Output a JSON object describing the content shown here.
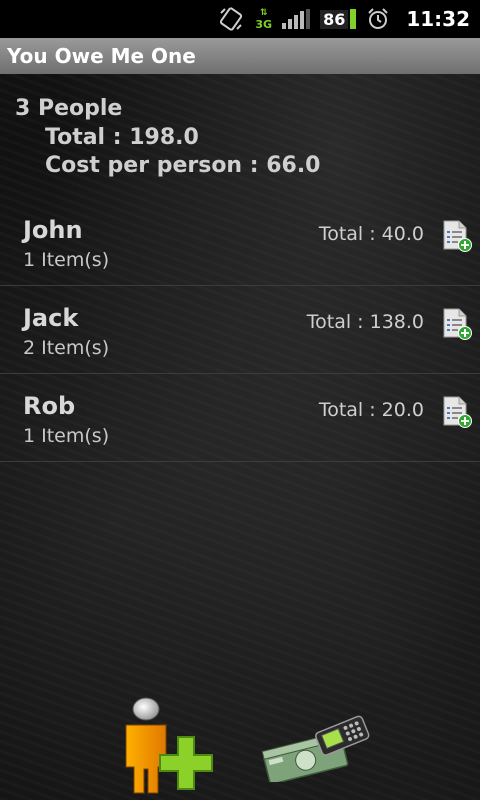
{
  "status_bar": {
    "network": "3G",
    "battery_level": "86",
    "time": "11:32"
  },
  "app": {
    "title": "You Owe Me One"
  },
  "summary": {
    "people_label": "3 People",
    "total_label": "Total : 198.0",
    "cost_per_person_label": "Cost per person : 66.0"
  },
  "people": [
    {
      "name": "John",
      "items": "1 Item(s)",
      "total": "Total : 40.0"
    },
    {
      "name": "Jack",
      "items": "2 Item(s)",
      "total": "Total : 138.0"
    },
    {
      "name": "Rob",
      "items": "1 Item(s)",
      "total": "Total : 20.0"
    }
  ],
  "icons": {
    "rotation": "screen-rotation-icon",
    "signal": "signal-strength-icon",
    "alarm": "alarm-clock-icon",
    "add_item": "add-item-document-icon",
    "add_person": "add-person-icon",
    "money": "money-phone-icon"
  },
  "colors": {
    "accent_green": "#7fd12a",
    "title_bar": "#8a8a8a"
  }
}
